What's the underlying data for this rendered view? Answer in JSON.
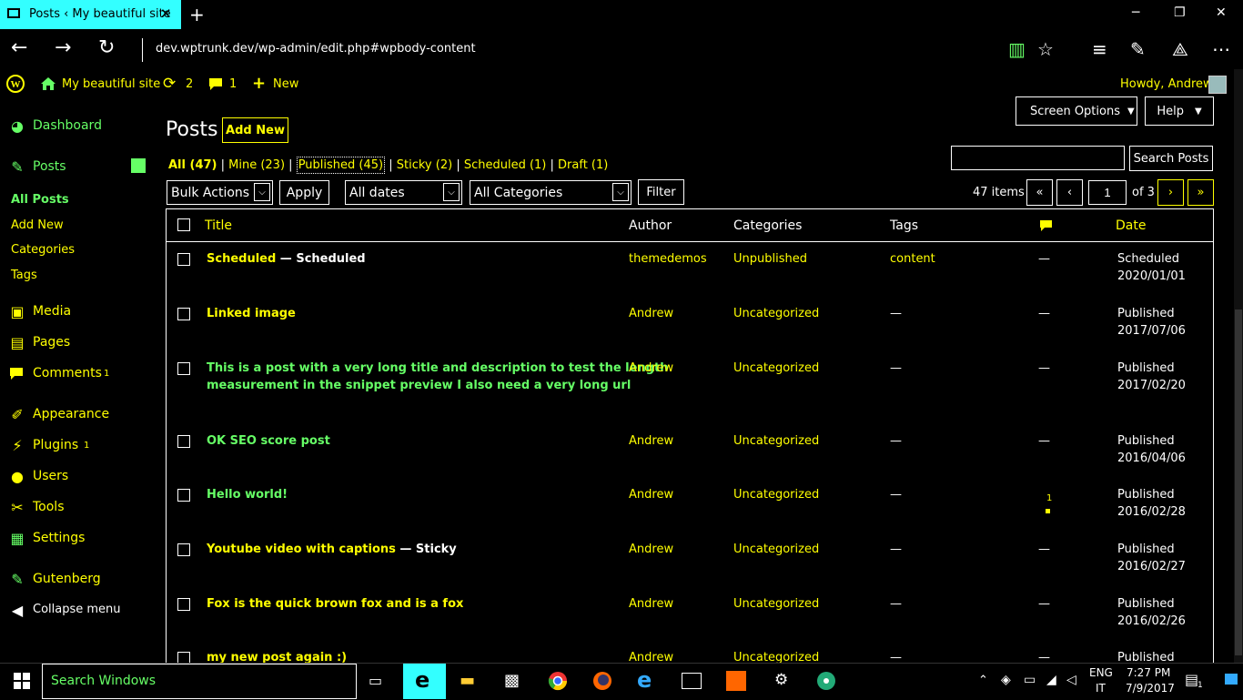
{
  "browser": {
    "tab_title": "Posts ‹ My beautiful site",
    "url": "dev.wptrunk.dev/wp-admin/edit.php#wpbody-content"
  },
  "adminbar": {
    "site_name": "My beautiful site",
    "updates_count": "2",
    "comments_count": "1",
    "new_label": "New",
    "howdy": "Howdy, Andrew"
  },
  "sidebar": {
    "items": [
      {
        "label": "Dashboard",
        "icon": "dashboard-icon"
      },
      {
        "label": "Posts",
        "icon": "pin-icon"
      },
      {
        "label": "Media",
        "icon": "media-icon"
      },
      {
        "label": "Pages",
        "icon": "pages-icon"
      },
      {
        "label": "Comments",
        "icon": "comment-icon",
        "badge": "1"
      },
      {
        "label": "Appearance",
        "icon": "brush-icon"
      },
      {
        "label": "Plugins",
        "icon": "plug-icon",
        "badge": "1"
      },
      {
        "label": "Users",
        "icon": "user-icon"
      },
      {
        "label": "Tools",
        "icon": "wrench-icon"
      },
      {
        "label": "Settings",
        "icon": "settings-icon"
      },
      {
        "label": "Gutenberg",
        "icon": "pencil-icon"
      },
      {
        "label": "Collapse menu",
        "icon": "collapse-icon"
      }
    ],
    "submenu": [
      "All Posts",
      "Add New",
      "Categories",
      "Tags"
    ]
  },
  "header": {
    "screen_options": "Screen Options",
    "help": "Help",
    "title": "Posts",
    "add_new": "Add New"
  },
  "filters": {
    "all": "All (47)",
    "mine": "Mine (23)",
    "published": "Published (45)",
    "sticky": "Sticky (2)",
    "scheduled": "Scheduled (1)",
    "draft": "Draft (1)",
    "search_button": "Search Posts",
    "search_value": "",
    "bulk_actions": "Bulk Actions",
    "apply": "Apply",
    "dates": "All dates",
    "categories": "All Categories",
    "filter": "Filter",
    "items": "47 items",
    "first": "«",
    "prev": "‹",
    "page": "1",
    "of_pages": "of 3",
    "next": "›",
    "last": "»"
  },
  "table": {
    "columns": {
      "title": "Title",
      "author": "Author",
      "categories": "Categories",
      "tags": "Tags",
      "date": "Date"
    },
    "rows": [
      {
        "title": "Scheduled",
        "state": " — Scheduled",
        "title_color": "#ff0",
        "author": "themedemos",
        "category": "Unpublished",
        "tags": "content",
        "comments": "—",
        "status": "Scheduled",
        "date": "2020/01/01"
      },
      {
        "title": "Linked image",
        "state": "",
        "title_color": "#ff0",
        "author": "Andrew",
        "category": "Uncategorized",
        "tags": "—",
        "comments": "—",
        "status": "Published",
        "date": "2017/07/06"
      },
      {
        "title": "This is a post with a very long title and description to test the length",
        "title2": "measurement in the snippet preview I also need a very long url",
        "state": "",
        "title_color": "#6f6",
        "author": "Andrew",
        "category": "Uncategorized",
        "tags": "—",
        "comments": "—",
        "status": "Published",
        "date": "2017/02/20"
      },
      {
        "title": "OK SEO score post",
        "state": "",
        "title_color": "#6f6",
        "author": "Andrew",
        "category": "Uncategorized",
        "tags": "—",
        "comments": "—",
        "status": "Published",
        "date": "2016/04/06"
      },
      {
        "title": "Hello world!",
        "state": "",
        "title_color": "#6f6",
        "author": "Andrew",
        "category": "Uncategorized",
        "tags": "—",
        "comments": "1",
        "status": "Published",
        "date": "2016/02/28"
      },
      {
        "title": "Youtube video with captions",
        "state": " — Sticky",
        "title_color": "#ff0",
        "author": "Andrew",
        "category": "Uncategorized",
        "tags": "—",
        "comments": "—",
        "status": "Published",
        "date": "2016/02/27"
      },
      {
        "title": "Fox is the quick brown fox and is a fox",
        "state": "",
        "title_color": "#ff0",
        "author": "Andrew",
        "category": "Uncategorized",
        "tags": "—",
        "comments": "—",
        "status": "Published",
        "date": "2016/02/26"
      },
      {
        "title": "my new post again :)",
        "state": "",
        "title_color": "#ff0",
        "author": "Andrew",
        "category": "Uncategorized",
        "tags": "—",
        "comments": "—",
        "status": "Published",
        "date": ""
      }
    ]
  },
  "taskbar": {
    "search": "Search Windows",
    "lang1": "ENG",
    "lang2": "IT",
    "time": "7:27 PM",
    "date": "7/9/2017",
    "notif": "1"
  },
  "colors": {
    "accent": "#ffff00",
    "link_green": "#66ff66",
    "tab": "#33ffff"
  }
}
